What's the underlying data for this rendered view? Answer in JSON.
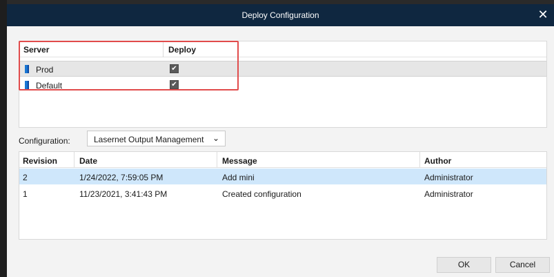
{
  "dialog": {
    "title": "Deploy Configuration",
    "close_glyph": "✕",
    "colors": {
      "titlebar": "#0f2740",
      "selection_blue": "#cfe7fb",
      "highlight_red": "#e14b4b",
      "server_icon": "#1976d2"
    }
  },
  "server_table": {
    "headers": {
      "server": "Server",
      "deploy": "Deploy"
    },
    "rows": [
      {
        "name": "Prod",
        "deploy_checked": true,
        "selected": true
      },
      {
        "name": "Default",
        "deploy_checked": true,
        "selected": false
      }
    ],
    "check_glyph": "✔"
  },
  "configuration": {
    "label": "Configuration:",
    "selected": "Lasernet Output Management",
    "arrow_glyph": "⌄"
  },
  "revision_table": {
    "headers": {
      "revision": "Revision",
      "date": "Date",
      "message": "Message",
      "author": "Author"
    },
    "rows": [
      {
        "revision": "2",
        "date": "1/24/2022, 7:59:05 PM",
        "message": "Add mini",
        "author": "Administrator",
        "selected": true
      },
      {
        "revision": "1",
        "date": "11/23/2021, 3:41:43 PM",
        "message": "Created configuration",
        "author": "Administrator",
        "selected": false
      }
    ]
  },
  "buttons": {
    "ok": "OK",
    "cancel": "Cancel"
  }
}
